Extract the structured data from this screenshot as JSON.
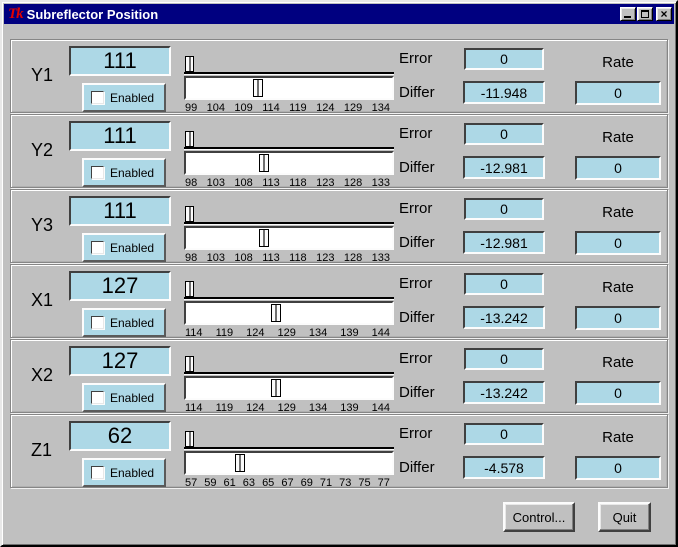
{
  "window": {
    "title": "Subreflector Position",
    "icon_text": "Tk",
    "controls": [
      {
        "name": "minimize"
      },
      {
        "name": "maximize"
      },
      {
        "name": "close"
      }
    ]
  },
  "labels": {
    "enabled": "Enabled",
    "error": "Error",
    "differ": "Differ",
    "rate": "Rate"
  },
  "colors": {
    "titlebar": "#000080",
    "background": "#c0c0c0",
    "field_bg": "#add8e6",
    "trough_bg": "#ffffff"
  },
  "axes": [
    {
      "label": "Y1",
      "value": 111,
      "enabled": false,
      "error": 0,
      "differ": "-11.948",
      "rate": 0,
      "ticks": [
        99,
        104,
        109,
        114,
        119,
        124,
        129,
        134
      ]
    },
    {
      "label": "Y2",
      "value": 111,
      "enabled": false,
      "error": 0,
      "differ": "-12.981",
      "rate": 0,
      "ticks": [
        98,
        103,
        108,
        113,
        118,
        123,
        128,
        133
      ]
    },
    {
      "label": "Y3",
      "value": 111,
      "enabled": false,
      "error": 0,
      "differ": "-12.981",
      "rate": 0,
      "ticks": [
        98,
        103,
        108,
        113,
        118,
        123,
        128,
        133
      ]
    },
    {
      "label": "X1",
      "value": 127,
      "enabled": false,
      "error": 0,
      "differ": "-13.242",
      "rate": 0,
      "ticks": [
        114,
        119,
        124,
        129,
        134,
        139,
        144
      ]
    },
    {
      "label": "X2",
      "value": 127,
      "enabled": false,
      "error": 0,
      "differ": "-13.242",
      "rate": 0,
      "ticks": [
        114,
        119,
        124,
        129,
        134,
        139,
        144
      ]
    },
    {
      "label": "Z1",
      "value": 62,
      "enabled": false,
      "error": 0,
      "differ": "-4.578",
      "rate": 0,
      "ticks": [
        57,
        59,
        61,
        63,
        65,
        67,
        69,
        71,
        73,
        75,
        77
      ]
    }
  ],
  "buttons": {
    "control": "Control...",
    "quit": "Quit"
  }
}
